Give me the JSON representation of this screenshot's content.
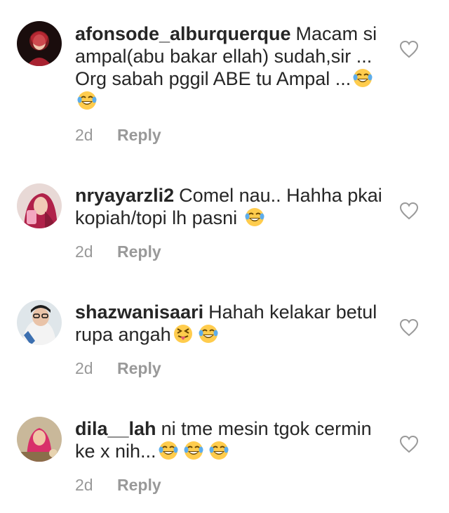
{
  "comments": [
    {
      "username": "afonsode_alburquerque",
      "text": "Macam si ampal(abu bakar ellah) sudah,sir ... Org sabah pggil ABE tu Ampal ...",
      "trailing_emojis": [
        "tears-of-joy",
        "tears-of-joy"
      ],
      "time": "2d",
      "reply_label": "Reply"
    },
    {
      "username": "nryayarzli2",
      "text": "Comel nau.. Hahha pkai kopiah/topi lh pasni",
      "trailing_emojis": [
        "tears-of-joy"
      ],
      "time": "2d",
      "reply_label": "Reply"
    },
    {
      "username": "shazwanisaari",
      "text": "Hahah kelakar betul rupa angah",
      "trailing_emojis": [
        "squinting-tongue",
        "tears-of-joy"
      ],
      "time": "2d",
      "reply_label": "Reply"
    },
    {
      "username": "dila__lah",
      "text": "ni tme mesin tgok cermin ke x nih...",
      "trailing_emojis": [
        "tears-of-joy",
        "tears-of-joy",
        "tears-of-joy"
      ],
      "time": "2d",
      "reply_label": "Reply"
    }
  ],
  "icons": {
    "like": "heart-outline-icon"
  },
  "colors": {
    "text": "#262626",
    "secondary": "#999999",
    "emoji_face": "#FFCC4D"
  }
}
